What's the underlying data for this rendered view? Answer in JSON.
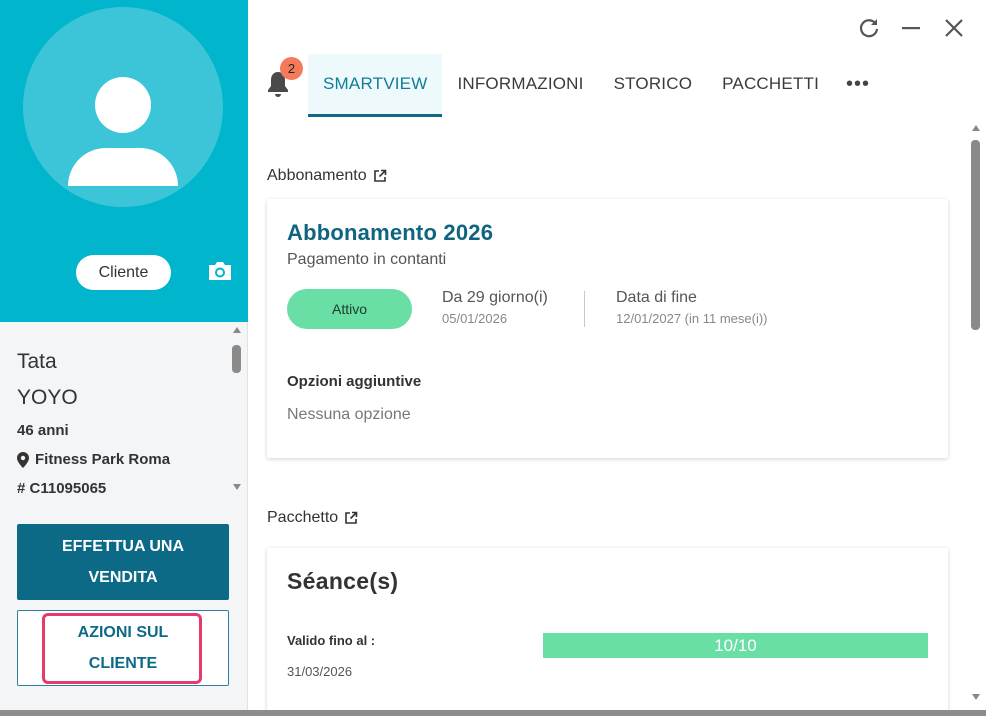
{
  "client": {
    "role": "Cliente",
    "first_name": "Tata",
    "last_name": "YOYO",
    "age": "46 anni",
    "location": "Fitness Park Roma",
    "code": "# C11095065"
  },
  "actions": {
    "sale_line1": "EFFETTUA UNA",
    "sale_line2": "VENDITA",
    "client_actions_line1": "AZIONI SUL",
    "client_actions_line2": "CLIENTE"
  },
  "notifications": {
    "count": "2"
  },
  "tabs": [
    {
      "label": "SMARTVIEW",
      "active": true
    },
    {
      "label": "INFORMAZIONI",
      "active": false
    },
    {
      "label": "STORICO",
      "active": false
    },
    {
      "label": "PACCHETTI",
      "active": false
    }
  ],
  "subscription": {
    "section_label": "Abbonamento",
    "name": "Abbonamento 2026",
    "payment": "Pagamento in contanti",
    "status": "Attivo",
    "since_label": "Da 29 giorno(i)",
    "since_date": "05/01/2026",
    "end_label": "Data di fine",
    "end_date": "12/01/2027 (in 11 mese(i))",
    "options_title": "Opzioni aggiuntive",
    "options_value": "Nessuna opzione"
  },
  "package": {
    "section_label": "Pacchetto",
    "name": "Séance(s)",
    "valid_label": "Valido fino al :",
    "valid_date": "31/03/2026",
    "usage_text": "10/10",
    "usage_fraction": 1.0
  },
  "colors": {
    "hero": "#00b5cc",
    "primary": "#0d6a87",
    "accent_green": "#69dea5",
    "badge": "#f37b5a",
    "highlight": "#e83a6a"
  },
  "icons": [
    "user-avatar-icon",
    "camera-icon",
    "location-pin-icon",
    "bell-icon",
    "refresh-icon",
    "minimize-icon",
    "close-icon",
    "more-icon",
    "external-link-icon"
  ]
}
